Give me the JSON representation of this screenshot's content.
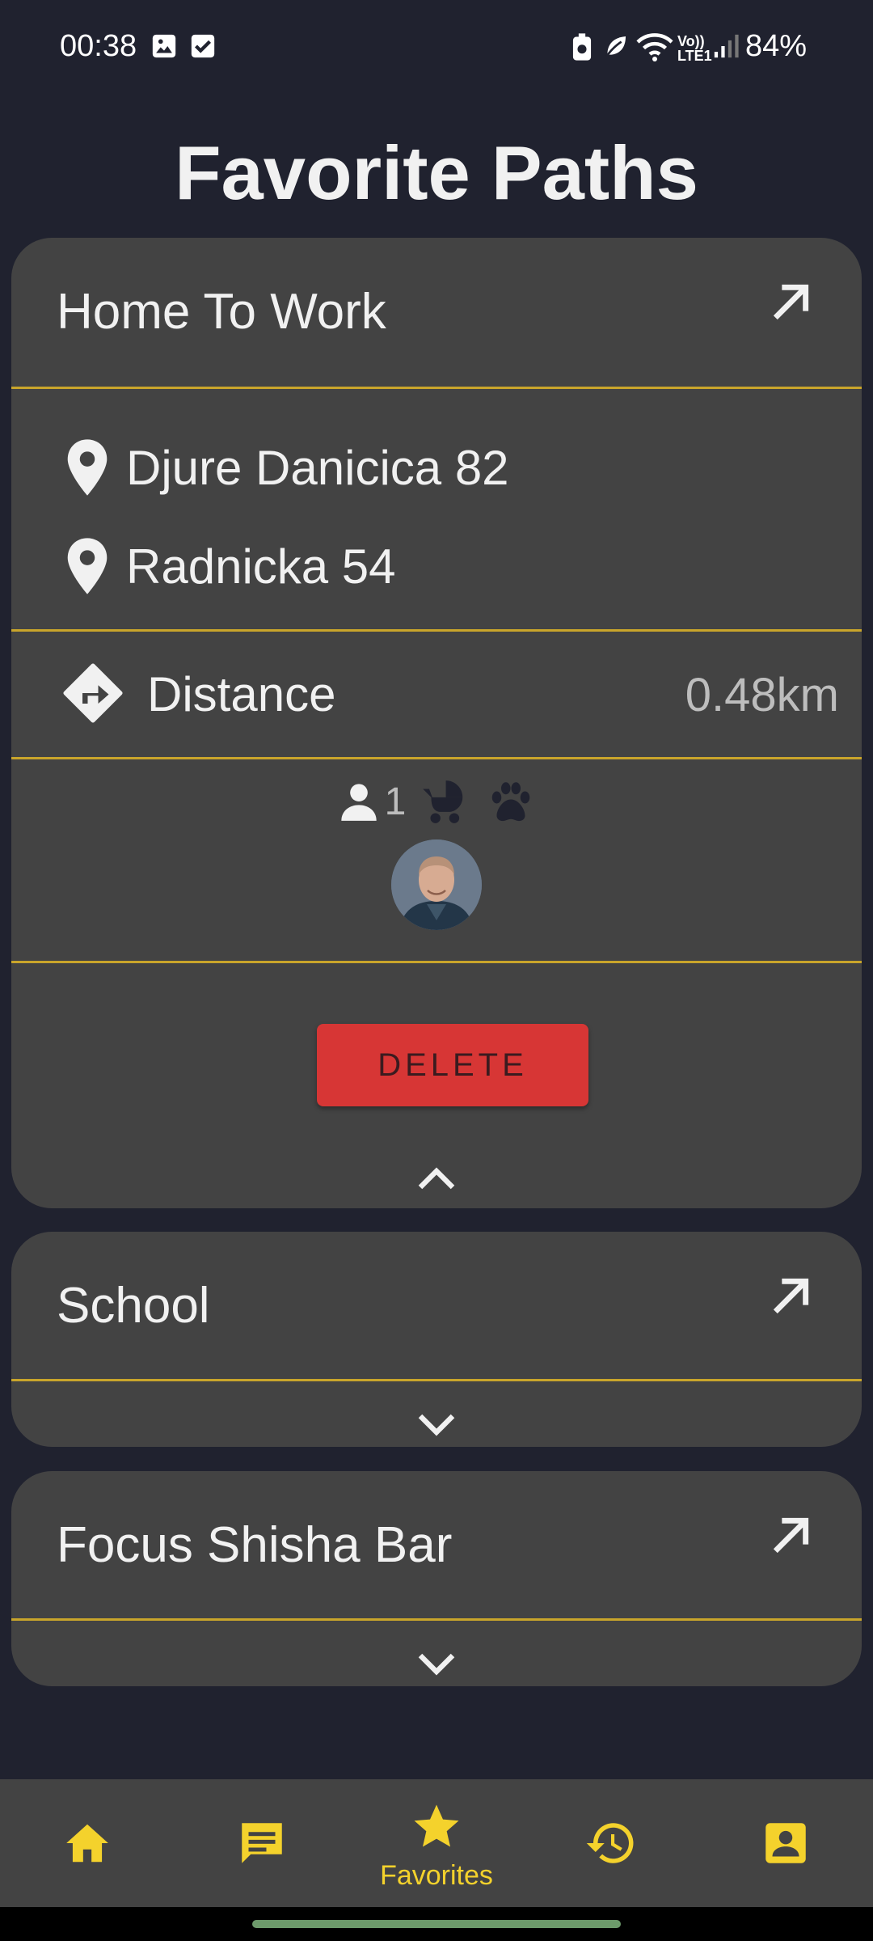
{
  "status_bar": {
    "time": "00:38",
    "battery": "84%",
    "network": "LTE1"
  },
  "page": {
    "title": "Favorite Paths"
  },
  "cards": [
    {
      "title": "Home To Work",
      "expanded": true,
      "from": "Djure Danicica 82",
      "to": "Radnicka 54",
      "distance_label": "Distance",
      "distance_value": "0.48km",
      "passengers": "1",
      "delete_label": "DELETE"
    },
    {
      "title": "School",
      "expanded": false
    },
    {
      "title": "Focus Shisha Bar",
      "expanded": false
    }
  ],
  "bottom_nav": {
    "items": [
      {
        "icon": "home-icon"
      },
      {
        "icon": "chat-icon"
      },
      {
        "icon": "star-icon",
        "label": "Favorites",
        "active": true
      },
      {
        "icon": "history-icon"
      },
      {
        "icon": "account-box-icon"
      }
    ]
  },
  "colors": {
    "background": "#20222f",
    "card": "#434343",
    "divider": "#c9a52b",
    "accent": "#f4d22c",
    "delete": "#d73635"
  }
}
